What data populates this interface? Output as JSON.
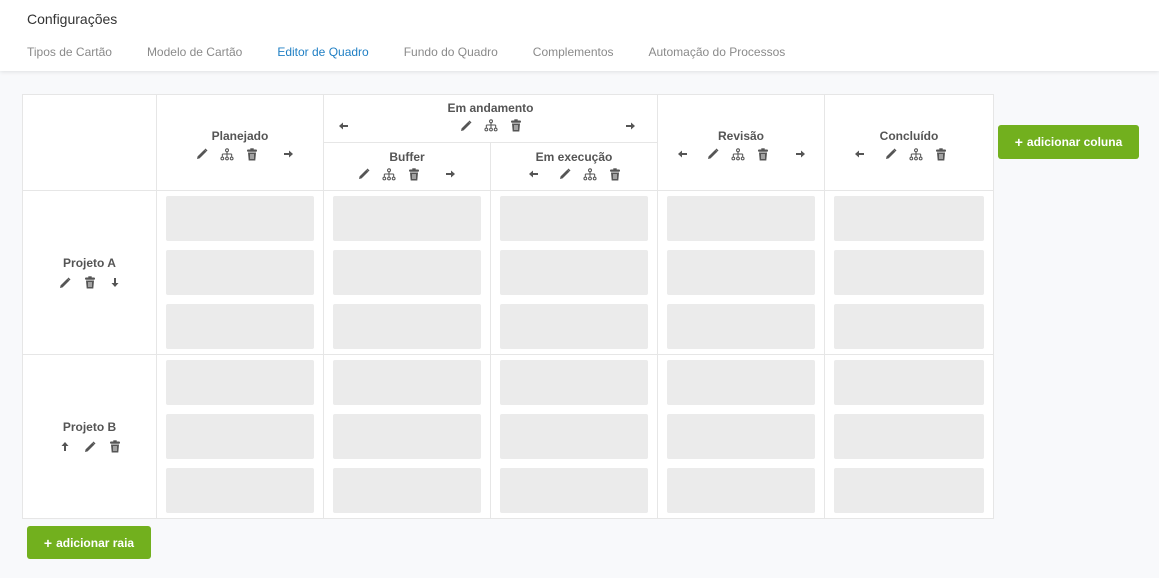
{
  "header": {
    "title": "Configurações",
    "tabs": [
      {
        "label": "Tipos de Cartão"
      },
      {
        "label": "Modelo de Cartão"
      },
      {
        "label": "Editor de Quadro",
        "active": true
      },
      {
        "label": "Fundo do Quadro"
      },
      {
        "label": "Complementos"
      },
      {
        "label": "Automação do Processos"
      }
    ]
  },
  "columns": {
    "planejado": {
      "label": "Planejado"
    },
    "em_andamento": {
      "label": "Em andamento"
    },
    "buffer": {
      "label": "Buffer"
    },
    "em_execucao": {
      "label": "Em execução"
    },
    "revisao": {
      "label": "Revisão"
    },
    "concluido": {
      "label": "Concluído"
    }
  },
  "lanes": [
    {
      "label": "Projeto A"
    },
    {
      "label": "Projeto B"
    }
  ],
  "buttons": {
    "add_column": "adicionar coluna",
    "add_lane": "adicionar raia",
    "plus": "+"
  },
  "icons": {
    "edit": "pencil-icon",
    "structure": "sitemap-icon",
    "delete": "trash-icon",
    "left": "arrow-left-icon",
    "right": "arrow-right-icon",
    "up": "arrow-up-icon",
    "down": "arrow-down-icon"
  },
  "colors": {
    "accent_tab": "#1f7fc4",
    "button_green": "#72b01e",
    "slot_gray": "#ebebeb"
  }
}
